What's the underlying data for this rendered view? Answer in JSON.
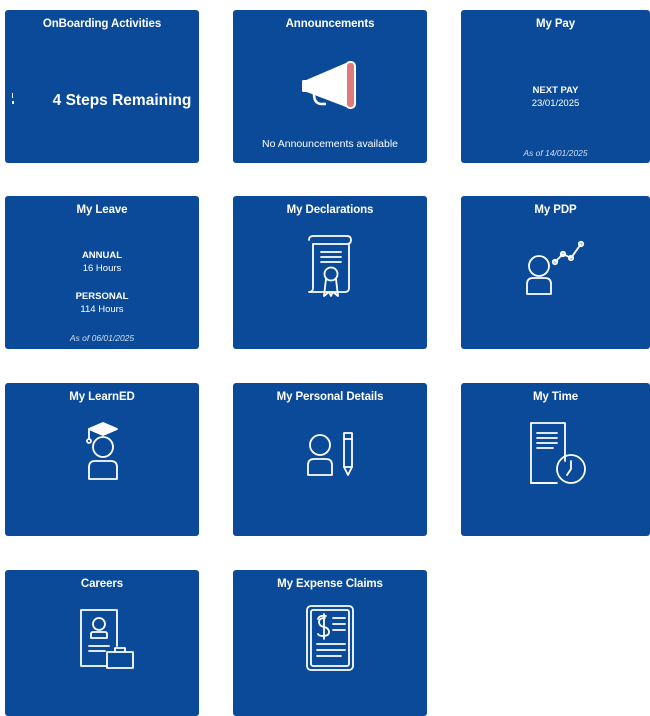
{
  "colors": {
    "tile_bg": "#0b4a99",
    "text": "#ffffff",
    "megaphone_accent": "#e07a7a"
  },
  "tiles": {
    "onboarding": {
      "title": "OnBoarding Activities",
      "status": "4 Steps Remaining"
    },
    "announcements": {
      "title": "Announcements",
      "message": "No Announcements available",
      "icon": "megaphone-icon"
    },
    "my_pay": {
      "title": "My Pay",
      "next_pay_label": "NEXT PAY",
      "next_pay_date": "23/01/2025",
      "as_of": "As of 14/01/2025"
    },
    "my_leave": {
      "title": "My Leave",
      "annual_label": "ANNUAL",
      "annual_value": "16 Hours",
      "personal_label": "PERSONAL",
      "personal_value": "114 Hours",
      "as_of": "As of 06/01/2025"
    },
    "my_declarations": {
      "title": "My Declarations",
      "icon": "certificate-scroll-icon"
    },
    "my_pdp": {
      "title": "My PDP",
      "icon": "person-growth-icon"
    },
    "my_learned": {
      "title": "My LearnED",
      "icon": "graduate-icon"
    },
    "my_personal_details": {
      "title": "My Personal Details",
      "icon": "person-pencil-icon"
    },
    "my_time": {
      "title": "My Time",
      "icon": "document-clock-icon"
    },
    "careers": {
      "title": "Careers",
      "icon": "resume-briefcase-icon"
    },
    "my_expense_claims": {
      "title": "My Expense Claims",
      "icon": "expense-receipt-icon"
    }
  }
}
